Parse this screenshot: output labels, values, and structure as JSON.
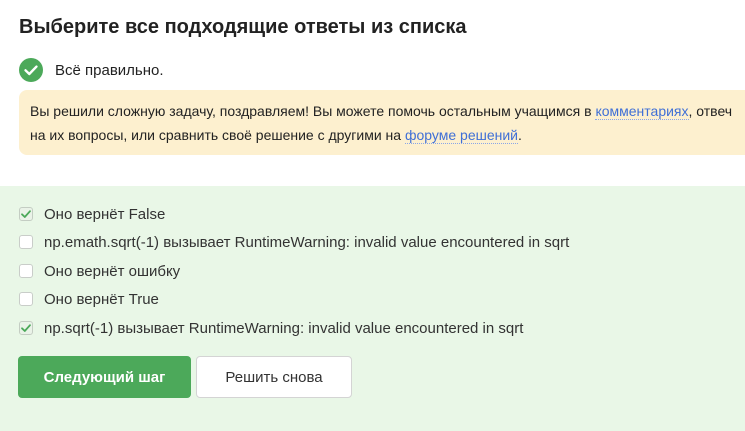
{
  "task": {
    "title": "Выберите все подходящие ответы из списка"
  },
  "status": {
    "text": "Всё правильно.",
    "icon": "check-circle-icon",
    "color": "#4ca95a"
  },
  "info": {
    "line1_before": "Вы решили сложную задачу, поздравляем! Вы можете помочь остальным учащимся в ",
    "comments_link": "комментариях",
    "line1_after": ", отвеч",
    "line2_before": "на их вопросы, или сравнить своё решение с другими на ",
    "forum_link": "форуме решений",
    "line2_after": ".",
    "background": "#fdf0cf",
    "link_color": "#3f6fd6"
  },
  "answers": {
    "background": "#e9f7e7",
    "options": [
      {
        "label": "Оно вернёт False",
        "checked": true
      },
      {
        "label": "np.emath.sqrt(-1) вызывает RuntimeWarning: invalid value encountered in sqrt",
        "checked": false
      },
      {
        "label": "Оно вернёт ошибку",
        "checked": false
      },
      {
        "label": "Оно вернёт True",
        "checked": false
      },
      {
        "label": "np.sqrt(-1) вызывает RuntimeWarning: invalid value encountered in sqrt",
        "checked": true
      }
    ]
  },
  "buttons": {
    "next_label": "Следующий шаг",
    "retry_label": "Решить снова",
    "primary_color": "#4ca95a"
  }
}
